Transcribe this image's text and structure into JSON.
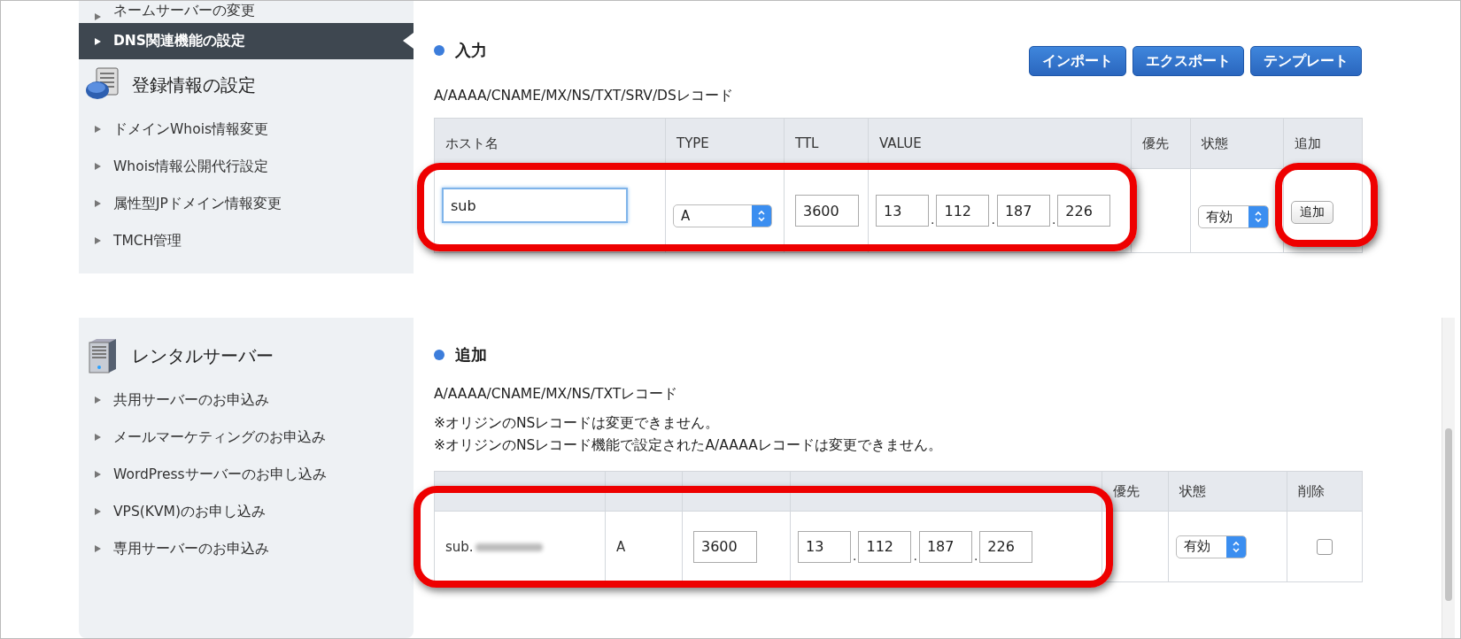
{
  "top": {
    "sidebar": {
      "items": [
        {
          "label": "ネームサーバーの変更",
          "selected": false
        },
        {
          "label": "DNS関連機能の設定",
          "selected": true
        }
      ],
      "sections": [
        {
          "kind": "registration",
          "title": "登録情報の設定",
          "items": [
            "ドメインWhois情報変更",
            "Whois情報公開代行設定",
            "属性型JPドメイン情報変更",
            "TMCH管理"
          ]
        }
      ]
    },
    "heading": "入力",
    "buttons": [
      "インポート",
      "エクスポート",
      "テンプレート"
    ],
    "record_types": "A/AAAA/CNAME/MX/NS/TXT/SRV/DSレコード",
    "table": {
      "columns": [
        {
          "label": "ホスト名"
        },
        {
          "label": "TYPE"
        },
        {
          "label": "TTL"
        },
        {
          "label": "VALUE"
        },
        {
          "label": "優先"
        },
        {
          "label": "状態"
        },
        {
          "label": "追加"
        }
      ],
      "row": {
        "host": "sub",
        "type": "A",
        "ttl": "3600",
        "value": [
          "13",
          "112",
          "187",
          "226"
        ],
        "separator": ".",
        "status": "有効",
        "action": "追加"
      }
    }
  },
  "bottom": {
    "sidebar": {
      "sections": [
        {
          "kind": "server",
          "title": "レンタルサーバー",
          "items": [
            "共用サーバーのお申込み",
            "メールマーケティングのお申込み",
            "WordPressサーバーのお申し込み",
            "VPS(KVM)のお申し込み",
            "専用サーバーのお申込み"
          ]
        }
      ]
    },
    "heading": "追加",
    "record_types": "A/AAAA/CNAME/MX/NS/TXTレコード",
    "notes": [
      "※オリジンのNSレコードは変更できません。",
      "※オリジンのNSレコード機能で設定されたA/AAAAレコードは変更できません。"
    ],
    "table": {
      "columns": [
        {},
        {},
        {},
        {},
        {
          "label": "優先"
        },
        {
          "label": "状態"
        },
        {
          "label": "削除"
        }
      ],
      "row": {
        "host": "sub.",
        "type": "A",
        "ttl": "3600",
        "value": [
          "13",
          "112",
          "187",
          "226"
        ],
        "separator": ".",
        "status": "有効",
        "delete_checked": false
      }
    }
  }
}
